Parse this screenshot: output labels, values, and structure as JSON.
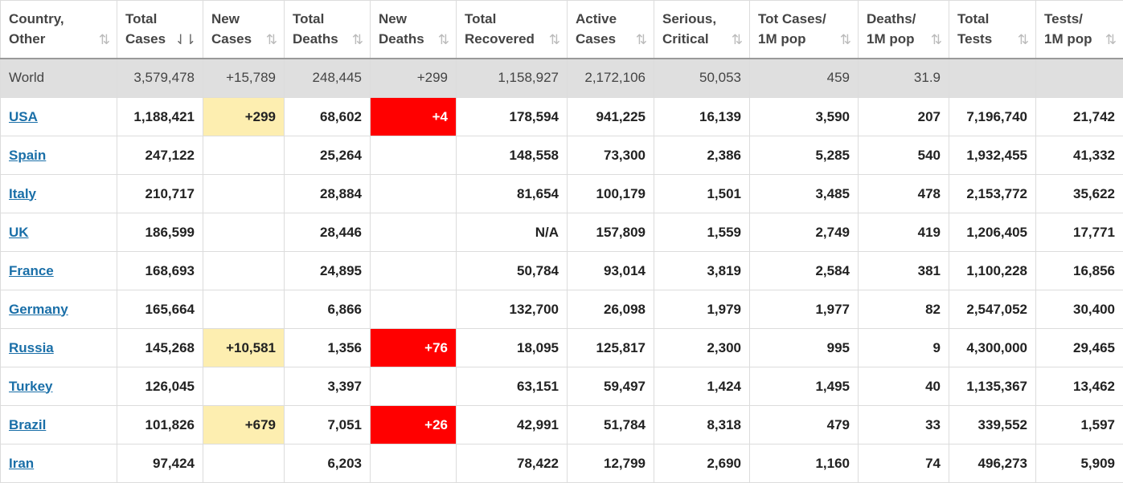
{
  "headers": [
    {
      "l1": "Country,",
      "l2": "Other",
      "sort": "⇅",
      "active": false
    },
    {
      "l1": "Total",
      "l2": "Cases",
      "sort": "⇃⇂",
      "active": true
    },
    {
      "l1": "New",
      "l2": "Cases",
      "sort": "⇅",
      "active": false
    },
    {
      "l1": "Total",
      "l2": "Deaths",
      "sort": "⇅",
      "active": false
    },
    {
      "l1": "New",
      "l2": "Deaths",
      "sort": "⇅",
      "active": false
    },
    {
      "l1": "Total",
      "l2": "Recovered",
      "sort": "⇅",
      "active": false
    },
    {
      "l1": "Active",
      "l2": "Cases",
      "sort": "⇅",
      "active": false
    },
    {
      "l1": "Serious,",
      "l2": "Critical",
      "sort": "⇅",
      "active": false
    },
    {
      "l1": "Tot Cases/",
      "l2": "1M pop",
      "sort": "⇅",
      "active": false
    },
    {
      "l1": "Deaths/",
      "l2": "1M pop",
      "sort": "⇅",
      "active": false
    },
    {
      "l1": "Total",
      "l2": "Tests",
      "sort": "⇅",
      "active": false
    },
    {
      "l1": "Tests/",
      "l2": "1M pop",
      "sort": "⇅",
      "active": false
    }
  ],
  "world": [
    "World",
    "3,579,478",
    "+15,789",
    "248,445",
    "+299",
    "1,158,927",
    "2,172,106",
    "50,053",
    "459",
    "31.9",
    "",
    ""
  ],
  "rows": [
    [
      "USA",
      "1,188,421",
      "+299",
      "68,602",
      "+4",
      "178,594",
      "941,225",
      "16,139",
      "3,590",
      "207",
      "7,196,740",
      "21,742"
    ],
    [
      "Spain",
      "247,122",
      "",
      "25,264",
      "",
      "148,558",
      "73,300",
      "2,386",
      "5,285",
      "540",
      "1,932,455",
      "41,332"
    ],
    [
      "Italy",
      "210,717",
      "",
      "28,884",
      "",
      "81,654",
      "100,179",
      "1,501",
      "3,485",
      "478",
      "2,153,772",
      "35,622"
    ],
    [
      "UK",
      "186,599",
      "",
      "28,446",
      "",
      "N/A",
      "157,809",
      "1,559",
      "2,749",
      "419",
      "1,206,405",
      "17,771"
    ],
    [
      "France",
      "168,693",
      "",
      "24,895",
      "",
      "50,784",
      "93,014",
      "3,819",
      "2,584",
      "381",
      "1,100,228",
      "16,856"
    ],
    [
      "Germany",
      "165,664",
      "",
      "6,866",
      "",
      "132,700",
      "26,098",
      "1,979",
      "1,977",
      "82",
      "2,547,052",
      "30,400"
    ],
    [
      "Russia",
      "145,268",
      "+10,581",
      "1,356",
      "+76",
      "18,095",
      "125,817",
      "2,300",
      "995",
      "9",
      "4,300,000",
      "29,465"
    ],
    [
      "Turkey",
      "126,045",
      "",
      "3,397",
      "",
      "63,151",
      "59,497",
      "1,424",
      "1,495",
      "40",
      "1,135,367",
      "13,462"
    ],
    [
      "Brazil",
      "101,826",
      "+679",
      "7,051",
      "+26",
      "42,991",
      "51,784",
      "8,318",
      "479",
      "33",
      "339,552",
      "1,597"
    ],
    [
      "Iran",
      "97,424",
      "",
      "6,203",
      "",
      "78,422",
      "12,799",
      "2,690",
      "1,160",
      "74",
      "496,273",
      "5,909"
    ]
  ],
  "colors": {
    "new_cases_highlight": "#fdeeb0",
    "new_deaths_highlight": "#ff0000",
    "link": "#1a6fa8",
    "world_row": "#dfdfdf"
  }
}
